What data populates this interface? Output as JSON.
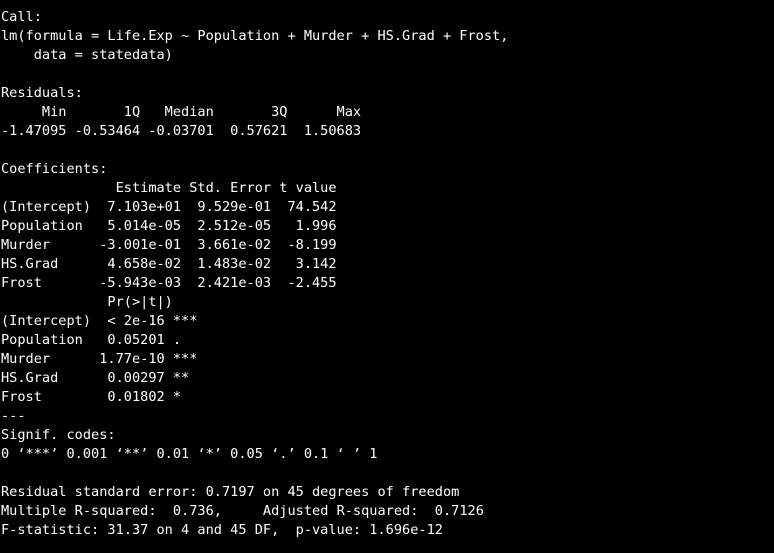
{
  "output": {
    "lines": [
      "Call:",
      "lm(formula = Life.Exp ~ Population + Murder + HS.Grad + Frost,",
      "    data = statedata)",
      "",
      "Residuals:",
      "     Min       1Q   Median       3Q      Max ",
      "-1.47095 -0.53464 -0.03701  0.57621  1.50683 ",
      "",
      "Coefficients:",
      "              Estimate Std. Error t value",
      "(Intercept)  7.103e+01  9.529e-01  74.542",
      "Population   5.014e-05  2.512e-05   1.996",
      "Murder      -3.001e-01  3.661e-02  -8.199",
      "HS.Grad      4.658e-02  1.483e-02   3.142",
      "Frost       -5.943e-03  2.421e-03  -2.455",
      "             Pr(>|t|)    ",
      "(Intercept)  < 2e-16 ***",
      "Population   0.05201 .  ",
      "Murder      1.77e-10 ***",
      "HS.Grad      0.00297 ** ",
      "Frost        0.01802 *  ",
      "---",
      "Signif. codes:  ",
      "0 ‘***’ 0.001 ‘**’ 0.01 ‘*’ 0.05 ‘.’ 0.1 ‘ ’ 1",
      "",
      "Residual standard error: 0.7197 on 45 degrees of freedom",
      "Multiple R-squared:  0.736,\tAdjusted R-squared:  0.7126 ",
      "F-statistic: 31.37 on 4 and 45 DF,  p-value: 1.696e-12"
    ]
  },
  "colors": {
    "background": "#000000",
    "text": "#ffffff"
  }
}
